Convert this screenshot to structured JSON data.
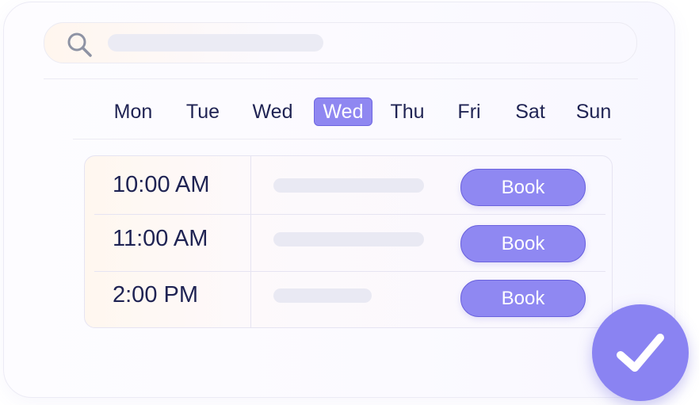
{
  "search": {
    "icon": "search-icon"
  },
  "days": {
    "items": [
      "Mon",
      "Tue",
      "Wed",
      "Wed",
      "Thu",
      "Fri",
      "Sat",
      "Sun"
    ],
    "selected_index": 3
  },
  "slots": [
    {
      "time": "10:00 AM",
      "book_label": "Book"
    },
    {
      "time": "11:00 AM",
      "book_label": "Book"
    },
    {
      "time": "2:00 PM",
      "book_label": "Book"
    }
  ],
  "confirm": {
    "icon": "checkmark-icon"
  },
  "colors": {
    "accent": "#8f88f2",
    "accent_border": "#6b63de",
    "text": "#1f2353",
    "placeholder": "#ebebf4"
  }
}
